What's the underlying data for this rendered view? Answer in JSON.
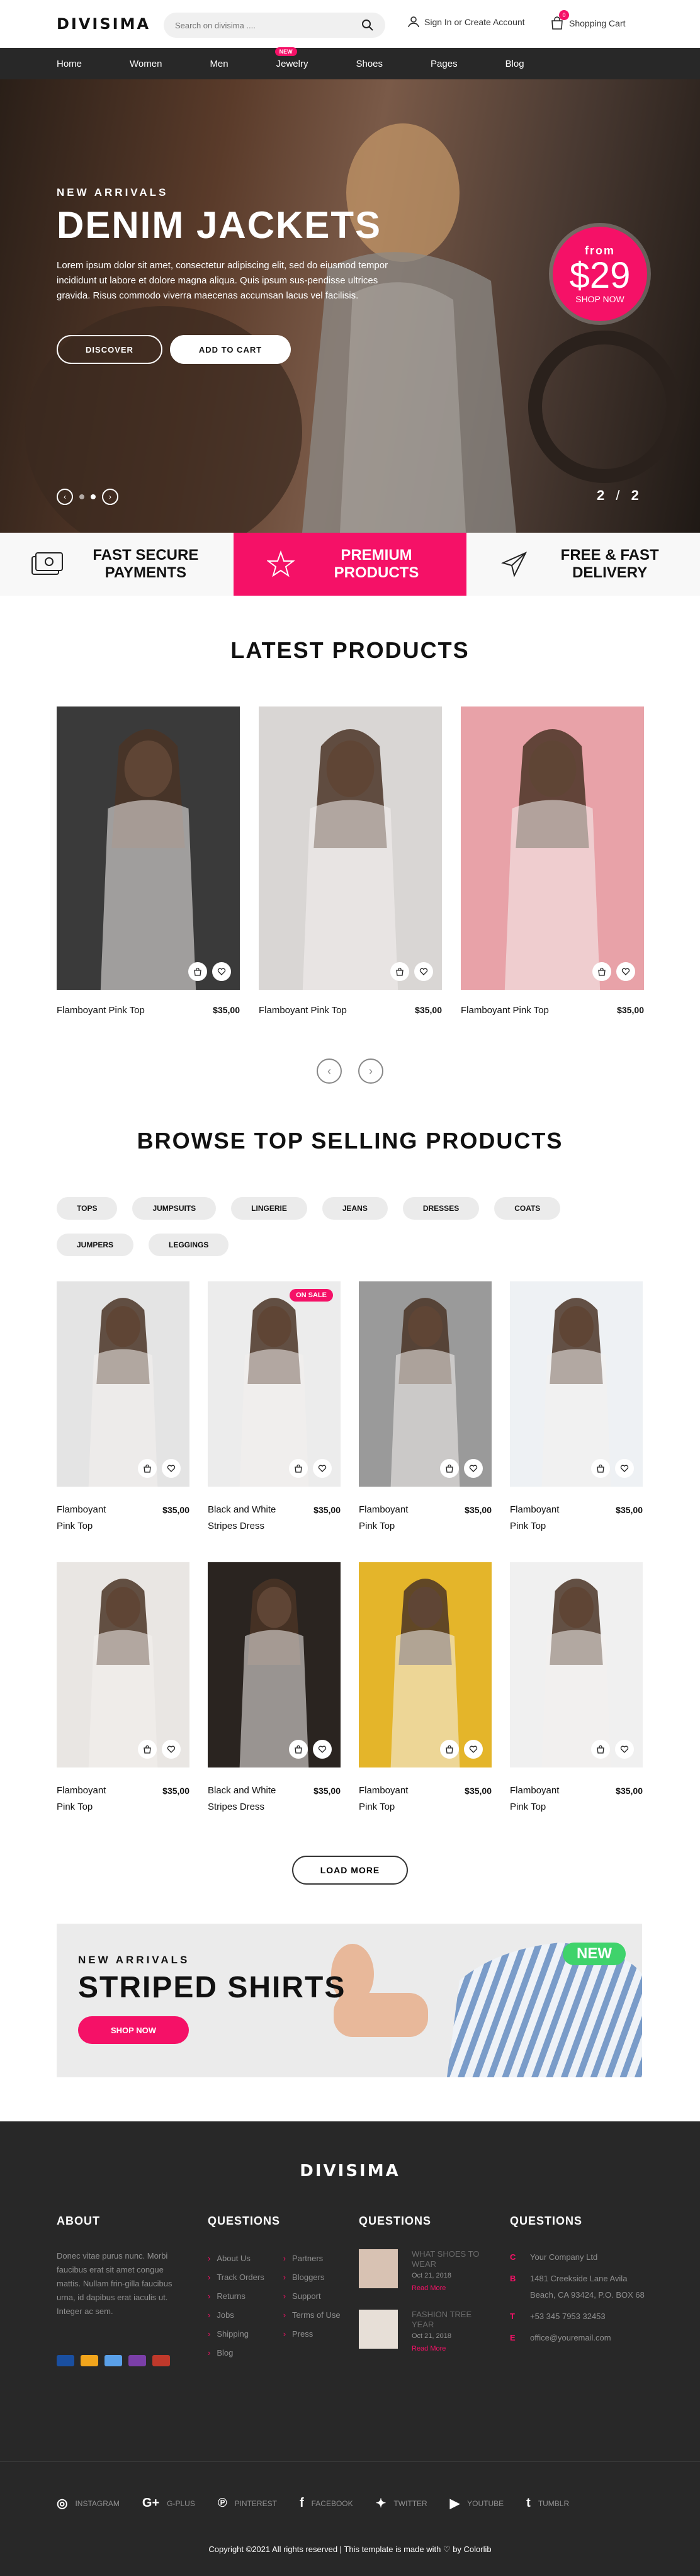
{
  "header": {
    "logo": "DIVISIMA",
    "search_placeholder": "Search on divisima ....",
    "account": "Sign In or Create Account",
    "cart_label": "Shopping Cart",
    "cart_count": "0"
  },
  "nav": {
    "items": [
      "Home",
      "Women",
      "Men",
      "Jewelry",
      "Shoes",
      "Pages",
      "Blog"
    ],
    "new_badge": "NEW"
  },
  "hero": {
    "eyebrow": "NEW ARRIVALS",
    "title": "DENIM JACKETS",
    "text": "Lorem ipsum dolor sit amet, consectetur adipiscing elit, sed do eiusmod tempor incididunt ut labore et dolore magna aliqua. Quis ipsum sus-pendisse ultrices gravida. Risus commodo viverra maecenas accumsan lacus vel facilisis.",
    "btn_discover": "DISCOVER",
    "btn_cart": "ADD TO CART",
    "price_from": "from",
    "price": "$29",
    "price_shop": "SHOP NOW",
    "slide_current": "2",
    "slide_sep": "/",
    "slide_total": "2"
  },
  "features": [
    {
      "label": "FAST SECURE PAYMENTS",
      "icon": "payment-card-icon"
    },
    {
      "label": "PREMIUM PRODUCTS",
      "icon": "star-icon"
    },
    {
      "label": "FREE & FAST DELIVERY",
      "icon": "paper-plane-icon"
    }
  ],
  "latest": {
    "title": "LATEST PRODUCTS",
    "products": [
      {
        "name": "Flamboyant Pink Top",
        "price": "$35,00",
        "color": "#3a3a3a"
      },
      {
        "name": "Flamboyant Pink Top",
        "price": "$35,00",
        "color": "#d9d6d4"
      },
      {
        "name": "Flamboyant Pink Top",
        "price": "$35,00",
        "color": "#e8a2a8"
      }
    ]
  },
  "browse": {
    "title": "BROWSE TOP SELLING PRODUCTS",
    "tags": [
      "TOPS",
      "JUMPSUITS",
      "LINGERIE",
      "JEANS",
      "DRESSES",
      "COATS",
      "JUMPERS",
      "LEGGINGS"
    ],
    "sale_badge": "ON SALE",
    "products": [
      {
        "name": "Flamboyant Pink Top",
        "price": "$35,00",
        "color": "#e4e4e4"
      },
      {
        "name": "Black and White Stripes Dress",
        "price": "$35,00",
        "color": "#ececec"
      },
      {
        "name": "Flamboyant Pink Top",
        "price": "$35,00",
        "color": "#9a9a9a"
      },
      {
        "name": "Flamboyant Pink Top",
        "price": "$35,00",
        "color": "#eef1f4"
      },
      {
        "name": "Flamboyant Pink Top",
        "price": "$35,00",
        "color": "#e9e6e3"
      },
      {
        "name": "Black and White Stripes Dress",
        "price": "$35,00",
        "color": "#2a2420"
      },
      {
        "name": "Flamboyant Pink Top",
        "price": "$35,00",
        "color": "#e4b52a"
      },
      {
        "name": "Flamboyant Pink Top",
        "price": "$35,00",
        "color": "#f0f0f0"
      }
    ],
    "load_more": "LOAD MORE"
  },
  "banner": {
    "eyebrow": "NEW ARRIVALS",
    "title": "STRIPED SHIRTS",
    "button": "SHOP NOW",
    "new": "NEW"
  },
  "footer": {
    "logo": "DIVISIMA",
    "about_title": "ABOUT",
    "about_text": "Donec vitae purus nunc. Morbi faucibus erat sit amet congue mattis. Nullam frin-gilla faucibus urna, id dapibus erat iaculis ut. Integer ac sem.",
    "questions_title": "QUESTIONS",
    "questions_col1": [
      "About Us",
      "Track Orders",
      "Returns",
      "Jobs",
      "Shipping",
      "Blog"
    ],
    "questions_col2": [
      "Partners",
      "Bloggers",
      "Support",
      "Terms of Use",
      "Press"
    ],
    "news": [
      {
        "title": "WHAT SHOES TO WEAR",
        "date": "Oct 21, 2018",
        "read": "Read More"
      },
      {
        "title": "FASHION TREE YEAR",
        "date": "Oct 21, 2018",
        "read": "Read More"
      }
    ],
    "contact": [
      {
        "icon": "C",
        "text": "Your Company Ltd"
      },
      {
        "icon": "B",
        "text": "1481 Creekside Lane Avila Beach, CA 93424, P.O. BOX 68"
      },
      {
        "icon": "T",
        "text": "+53 345 7953 32453"
      },
      {
        "icon": "E",
        "text": "office@youremail.com"
      }
    ],
    "social": [
      "INSTAGRAM",
      "G-PLUS",
      "PINTEREST",
      "FACEBOOK",
      "TWITTER",
      "YOUTUBE",
      "TUMBLR"
    ],
    "copyright": "Copyright ©2021 All rights reserved | This template is made with ♡ by Colorlib"
  },
  "colors": {
    "accent": "#f51167",
    "dark": "#282828",
    "new_green": "#3fd36b"
  }
}
